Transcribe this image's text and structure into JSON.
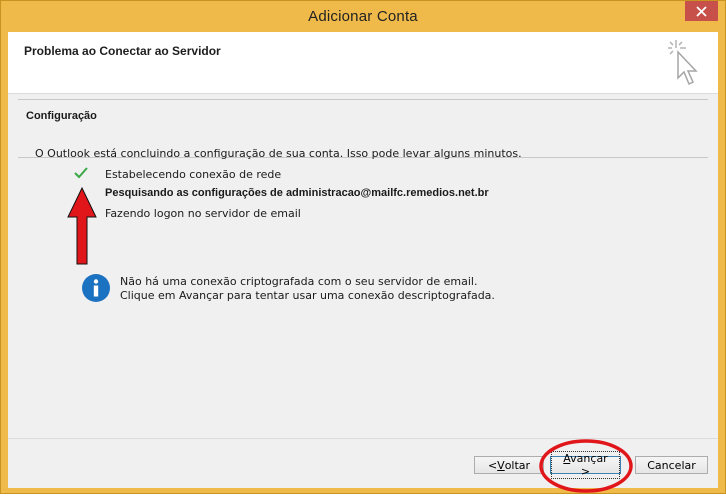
{
  "window": {
    "title": "Adicionar Conta"
  },
  "header": {
    "title": "Problema ao Conectar ao Servidor"
  },
  "group": {
    "title": "Configuração"
  },
  "content": {
    "intro": "O Outlook está concluindo a configuração de sua conta. Isso pode levar alguns minutos.",
    "steps": [
      "Estabelecendo conexão de rede",
      "Pesquisando as configurações de administracao@mailfc.remedios.net.br",
      "Fazendo logon no servidor de email"
    ],
    "info": [
      "Não há uma conexão criptografada com o seu servidor de email.",
      "Clique em Avançar para tentar usar uma conexão descriptografada."
    ]
  },
  "buttons": {
    "back_prefix": "< ",
    "back_key": "V",
    "back_rest": "oltar",
    "next_key": "A",
    "next_rest": "vançar >",
    "cancel": "Cancelar"
  },
  "colors": {
    "titlebar": "#f0ba4a",
    "close": "#c7504a",
    "info_icon": "#1b72c0",
    "check": "#3aa845",
    "annotation": "#e0161b"
  },
  "icons": {
    "close": "close-icon",
    "cursor": "cursor-sparkle-icon",
    "check": "check-icon",
    "info": "info-icon"
  }
}
